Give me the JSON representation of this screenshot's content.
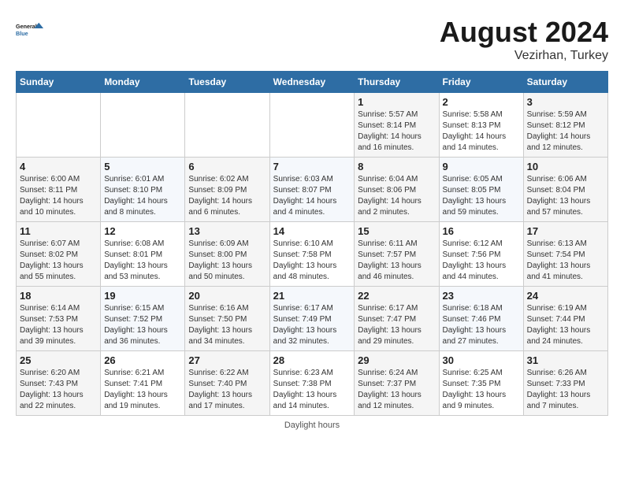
{
  "header": {
    "logo_line1": "General",
    "logo_line2": "Blue",
    "month_title": "August 2024",
    "location": "Vezirhan, Turkey"
  },
  "footer": {
    "daylight_label": "Daylight hours"
  },
  "weekdays": [
    "Sunday",
    "Monday",
    "Tuesday",
    "Wednesday",
    "Thursday",
    "Friday",
    "Saturday"
  ],
  "weeks": [
    [
      {
        "day": "",
        "info": ""
      },
      {
        "day": "",
        "info": ""
      },
      {
        "day": "",
        "info": ""
      },
      {
        "day": "",
        "info": ""
      },
      {
        "day": "1",
        "info": "Sunrise: 5:57 AM\nSunset: 8:14 PM\nDaylight: 14 hours\nand 16 minutes."
      },
      {
        "day": "2",
        "info": "Sunrise: 5:58 AM\nSunset: 8:13 PM\nDaylight: 14 hours\nand 14 minutes."
      },
      {
        "day": "3",
        "info": "Sunrise: 5:59 AM\nSunset: 8:12 PM\nDaylight: 14 hours\nand 12 minutes."
      }
    ],
    [
      {
        "day": "4",
        "info": "Sunrise: 6:00 AM\nSunset: 8:11 PM\nDaylight: 14 hours\nand 10 minutes."
      },
      {
        "day": "5",
        "info": "Sunrise: 6:01 AM\nSunset: 8:10 PM\nDaylight: 14 hours\nand 8 minutes."
      },
      {
        "day": "6",
        "info": "Sunrise: 6:02 AM\nSunset: 8:09 PM\nDaylight: 14 hours\nand 6 minutes."
      },
      {
        "day": "7",
        "info": "Sunrise: 6:03 AM\nSunset: 8:07 PM\nDaylight: 14 hours\nand 4 minutes."
      },
      {
        "day": "8",
        "info": "Sunrise: 6:04 AM\nSunset: 8:06 PM\nDaylight: 14 hours\nand 2 minutes."
      },
      {
        "day": "9",
        "info": "Sunrise: 6:05 AM\nSunset: 8:05 PM\nDaylight: 13 hours\nand 59 minutes."
      },
      {
        "day": "10",
        "info": "Sunrise: 6:06 AM\nSunset: 8:04 PM\nDaylight: 13 hours\nand 57 minutes."
      }
    ],
    [
      {
        "day": "11",
        "info": "Sunrise: 6:07 AM\nSunset: 8:02 PM\nDaylight: 13 hours\nand 55 minutes."
      },
      {
        "day": "12",
        "info": "Sunrise: 6:08 AM\nSunset: 8:01 PM\nDaylight: 13 hours\nand 53 minutes."
      },
      {
        "day": "13",
        "info": "Sunrise: 6:09 AM\nSunset: 8:00 PM\nDaylight: 13 hours\nand 50 minutes."
      },
      {
        "day": "14",
        "info": "Sunrise: 6:10 AM\nSunset: 7:58 PM\nDaylight: 13 hours\nand 48 minutes."
      },
      {
        "day": "15",
        "info": "Sunrise: 6:11 AM\nSunset: 7:57 PM\nDaylight: 13 hours\nand 46 minutes."
      },
      {
        "day": "16",
        "info": "Sunrise: 6:12 AM\nSunset: 7:56 PM\nDaylight: 13 hours\nand 44 minutes."
      },
      {
        "day": "17",
        "info": "Sunrise: 6:13 AM\nSunset: 7:54 PM\nDaylight: 13 hours\nand 41 minutes."
      }
    ],
    [
      {
        "day": "18",
        "info": "Sunrise: 6:14 AM\nSunset: 7:53 PM\nDaylight: 13 hours\nand 39 minutes."
      },
      {
        "day": "19",
        "info": "Sunrise: 6:15 AM\nSunset: 7:52 PM\nDaylight: 13 hours\nand 36 minutes."
      },
      {
        "day": "20",
        "info": "Sunrise: 6:16 AM\nSunset: 7:50 PM\nDaylight: 13 hours\nand 34 minutes."
      },
      {
        "day": "21",
        "info": "Sunrise: 6:17 AM\nSunset: 7:49 PM\nDaylight: 13 hours\nand 32 minutes."
      },
      {
        "day": "22",
        "info": "Sunrise: 6:17 AM\nSunset: 7:47 PM\nDaylight: 13 hours\nand 29 minutes."
      },
      {
        "day": "23",
        "info": "Sunrise: 6:18 AM\nSunset: 7:46 PM\nDaylight: 13 hours\nand 27 minutes."
      },
      {
        "day": "24",
        "info": "Sunrise: 6:19 AM\nSunset: 7:44 PM\nDaylight: 13 hours\nand 24 minutes."
      }
    ],
    [
      {
        "day": "25",
        "info": "Sunrise: 6:20 AM\nSunset: 7:43 PM\nDaylight: 13 hours\nand 22 minutes."
      },
      {
        "day": "26",
        "info": "Sunrise: 6:21 AM\nSunset: 7:41 PM\nDaylight: 13 hours\nand 19 minutes."
      },
      {
        "day": "27",
        "info": "Sunrise: 6:22 AM\nSunset: 7:40 PM\nDaylight: 13 hours\nand 17 minutes."
      },
      {
        "day": "28",
        "info": "Sunrise: 6:23 AM\nSunset: 7:38 PM\nDaylight: 13 hours\nand 14 minutes."
      },
      {
        "day": "29",
        "info": "Sunrise: 6:24 AM\nSunset: 7:37 PM\nDaylight: 13 hours\nand 12 minutes."
      },
      {
        "day": "30",
        "info": "Sunrise: 6:25 AM\nSunset: 7:35 PM\nDaylight: 13 hours\nand 9 minutes."
      },
      {
        "day": "31",
        "info": "Sunrise: 6:26 AM\nSunset: 7:33 PM\nDaylight: 13 hours\nand 7 minutes."
      }
    ]
  ]
}
